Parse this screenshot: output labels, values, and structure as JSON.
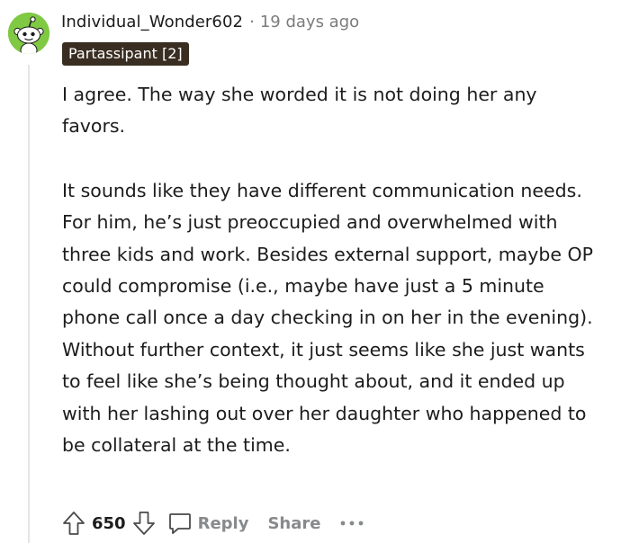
{
  "comment": {
    "author": "Individual_Wonder602",
    "separator": "·",
    "timestamp": "19 days ago",
    "flair": "Partassipant [2]",
    "avatar_icon": "snoo-avatar-icon",
    "avatar_color": "#7fc943",
    "flair_color": "#3a2d21",
    "paragraphs": [
      "I agree. The way she worded it is not doing her any favors.",
      "It sounds like they have different communication needs. For him, he’s just preoccupied and overwhelmed with three kids and work. Besides external support, maybe OP could compromise (i.e., maybe have just a 5 minute phone call once a day checking in on her in the evening). Without further context, it just seems like she just wants to feel like she’s being thought about, and it ended up with her lashing out over her daughter who happened to be collateral at the time."
    ]
  },
  "actions": {
    "upvote_icon": "upvote-arrow-icon",
    "score": "650",
    "downvote_icon": "downvote-arrow-icon",
    "reply_icon": "speech-bubble-icon",
    "reply_label": "Reply",
    "share_label": "Share",
    "more_icon": "ellipsis-icon"
  }
}
